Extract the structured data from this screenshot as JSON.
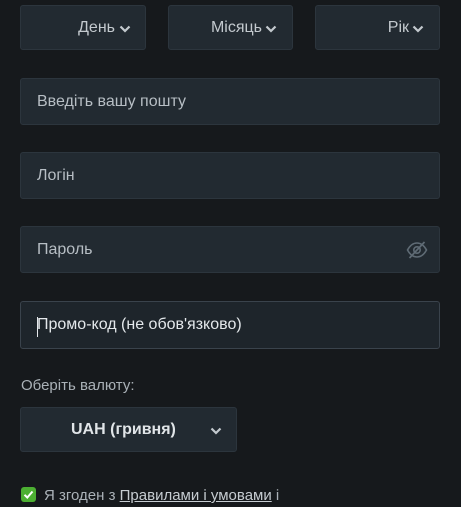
{
  "birthdate": {
    "day": "День",
    "month": "Місяць",
    "year": "Рік"
  },
  "form": {
    "email_placeholder": "Введіть вашу пошту",
    "login_placeholder": "Логін",
    "password_placeholder": "Пароль",
    "promo_placeholder": "Промо-код (не обов'язково)"
  },
  "currency": {
    "label": "Оберіть валюту:",
    "selected": "UAH (гривня)"
  },
  "terms": {
    "prefix": "Я згоден з",
    "link": "Правилами і умовами",
    "suffix": "і",
    "checked": true
  },
  "colors": {
    "background": "#16191c",
    "field": "#222a31",
    "checkbox": "#4caf32"
  }
}
